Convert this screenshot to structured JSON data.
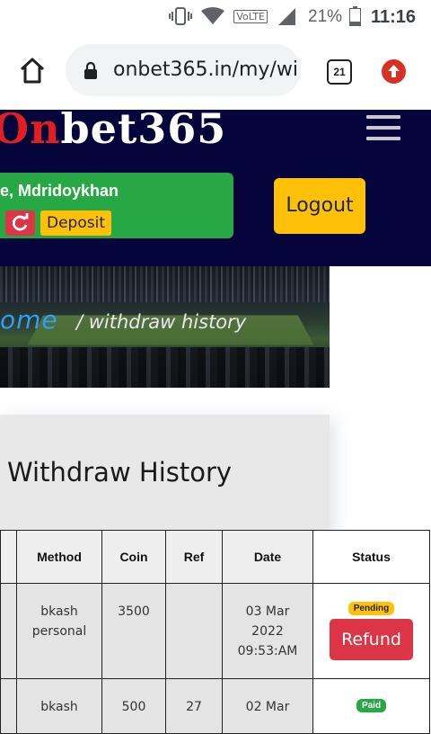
{
  "status_bar": {
    "battery": "21%",
    "time": "11:16",
    "network": "VoLTE"
  },
  "browser": {
    "url": "onbet365.in/my/wi",
    "tab_count": "21"
  },
  "header": {
    "logo_prefix": "On",
    "logo_rest": "bet365",
    "welcome": "e, Mdridoykhan",
    "deposit_label": "Deposit",
    "logout_label": "Logout"
  },
  "banner": {
    "home_crumb": "ome",
    "page_crumb": "/ withdraw history"
  },
  "page": {
    "title": "Withdraw History"
  },
  "table": {
    "headers": {
      "method": "Method",
      "coin": "Coin",
      "ref": "Ref",
      "date": "Date",
      "status": "Status"
    },
    "rows": [
      {
        "method_line1": "bkash",
        "method_line2": "personal",
        "coin": "3500",
        "ref": "",
        "date_line1": "03 Mar",
        "date_line2": "2022",
        "date_line3": "09:53:AM",
        "status": "Pending",
        "action": "Refund"
      },
      {
        "method_line1": "bkash",
        "method_line2": "",
        "coin": "500",
        "ref": "27",
        "date_line1": "02 Mar",
        "date_line2": "",
        "date_line3": "",
        "status": "Paid",
        "action": ""
      }
    ]
  },
  "colors": {
    "header_bg": "#05043b",
    "accent_yellow": "#ffc107",
    "success_green": "#28a745",
    "danger_red": "#dc3545"
  }
}
